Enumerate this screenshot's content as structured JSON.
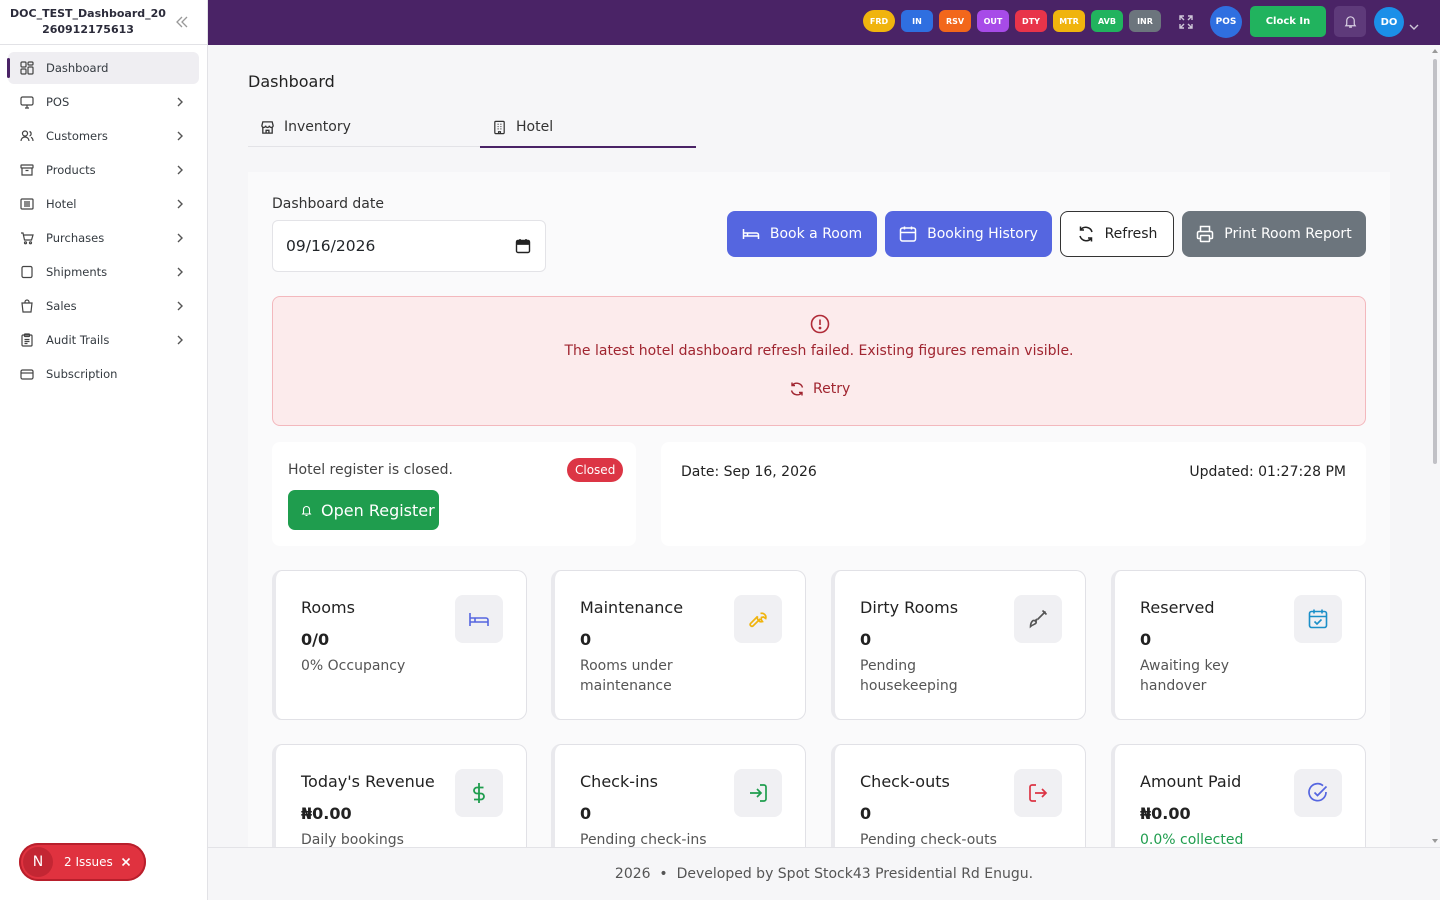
{
  "app": {
    "brand": "DOC_TEST_Dashboard_20260912175613"
  },
  "sidebar": {
    "items": [
      {
        "label": "Dashboard",
        "icon": "dashboard-icon",
        "active": true
      },
      {
        "label": "POS",
        "icon": "monitor-icon"
      },
      {
        "label": "Customers",
        "icon": "users-icon"
      },
      {
        "label": "Products",
        "icon": "box-icon"
      },
      {
        "label": "Hotel",
        "icon": "hotel-icon"
      },
      {
        "label": "Purchases",
        "icon": "cart-icon"
      },
      {
        "label": "Shipments",
        "icon": "shipment-icon"
      },
      {
        "label": "Sales",
        "icon": "sales-icon"
      },
      {
        "label": "Audit Trails",
        "icon": "clipboard-icon"
      },
      {
        "label": "Subscription",
        "icon": "card-icon"
      }
    ]
  },
  "topbar": {
    "badges": [
      {
        "label": "FRD",
        "color": "#f0b40e"
      },
      {
        "label": "IN",
        "color": "#2f6fe0"
      },
      {
        "label": "RSV",
        "color": "#f2671b"
      },
      {
        "label": "OUT",
        "color": "#a74be8"
      },
      {
        "label": "DTY",
        "color": "#e8344a"
      },
      {
        "label": "MTR",
        "color": "#f0b40e"
      },
      {
        "label": "AVB",
        "color": "#21b35e"
      },
      {
        "label": "INR",
        "color": "#6c757d"
      }
    ],
    "pos_label": "POS",
    "clock_in_label": "Clock In",
    "avatar_initials": "DO"
  },
  "page": {
    "title": "Dashboard",
    "tabs": [
      {
        "label": "Inventory"
      },
      {
        "label": "Hotel"
      }
    ]
  },
  "hotel": {
    "date_label": "Dashboard date",
    "date_value": "09/16/2026",
    "buttons": {
      "book": "Book a Room",
      "history": "Booking History",
      "refresh": "Refresh",
      "print": "Print Room Report"
    },
    "alert": {
      "message": "The latest hotel dashboard refresh failed. Existing figures remain visible.",
      "retry": "Retry"
    },
    "register": {
      "status_text": "Hotel register is closed.",
      "badge": "Closed",
      "open_button": "Open Register"
    },
    "info": {
      "date": "Date: Sep 16, 2026",
      "updated": "Updated: 01:27:28 PM"
    },
    "stats": [
      {
        "title": "Rooms",
        "value": "0/0",
        "sub": "0% Occupancy",
        "icon": "bed-icon",
        "color": "#5566e0"
      },
      {
        "title": "Maintenance",
        "value": "0",
        "sub": "Rooms under maintenance",
        "icon": "wrench-icon",
        "color": "#f0b40e"
      },
      {
        "title": "Dirty Rooms",
        "value": "0",
        "sub": "Pending housekeeping",
        "icon": "brush-icon",
        "color": "#555555"
      },
      {
        "title": "Reserved",
        "value": "0",
        "sub": "Awaiting key handover",
        "icon": "calendar-check-icon",
        "color": "#1b8fc8"
      },
      {
        "title": "Today's Revenue",
        "value": "₦0.00",
        "sub": "Daily bookings",
        "icon": "dollar-icon",
        "color": "#1f9d4e"
      },
      {
        "title": "Check-ins",
        "value": "0",
        "sub": "Pending check-ins",
        "icon": "login-icon",
        "color": "#1f9d4e"
      },
      {
        "title": "Check-outs",
        "value": "0",
        "sub": "Pending check-outs",
        "icon": "logout-icon",
        "color": "#dc3545"
      },
      {
        "title": "Amount Paid",
        "value": "₦0.00",
        "sub": "0.0% collected",
        "icon": "check-circle-icon",
        "color": "#5566e0"
      }
    ]
  },
  "footer": {
    "text": "2026  •  Developed by Spot Stock43 Presidential Rd Enugu."
  },
  "issues": {
    "initial": "N",
    "label": "2 Issues"
  }
}
